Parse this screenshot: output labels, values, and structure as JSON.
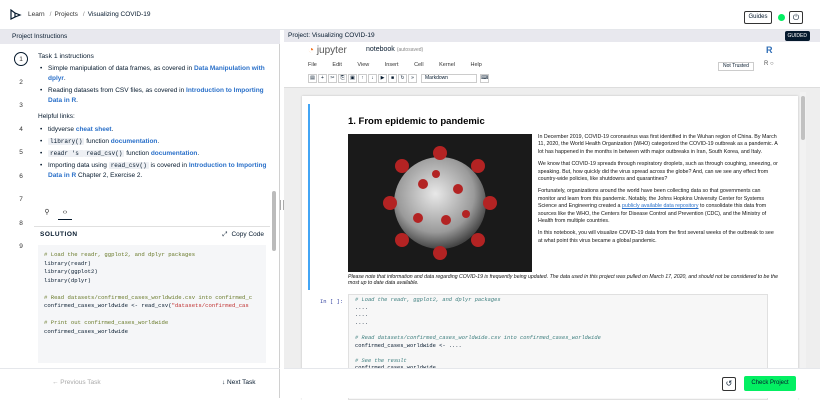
{
  "breadcrumb": {
    "learn": "Learn",
    "projects": "Projects",
    "current": "Visualizing COVID-19"
  },
  "topbar": {
    "guides_label": "Guides",
    "power_icon": "⏻"
  },
  "left_panel": {
    "header": "Project Instructions",
    "steps": [
      "1",
      "2",
      "3",
      "4",
      "5",
      "6",
      "7",
      "8",
      "9"
    ],
    "task_title": "Task 1 instructions",
    "bullets": [
      {
        "pre": "Simple manipulation of data frames, as covered in ",
        "link": "Data Manipulation with dplyr",
        "post": "."
      },
      {
        "pre": "Reading datasets from CSV files, as covered in ",
        "link": "Introduction to Importing Data in R",
        "post": "."
      }
    ],
    "helpful_title": "Helpful links:",
    "helpful": [
      {
        "pre": "tidyverse ",
        "link": "cheat sheet",
        "post": "."
      },
      {
        "code": "library()",
        "mid": " function ",
        "link": "documentation",
        "post": "."
      },
      {
        "pre": "readr 's ",
        "code": "read_csv()",
        "mid": " function ",
        "link": "documentation",
        "post": "."
      },
      {
        "pre": "Importing data using ",
        "code": "read_csv()",
        "mid": " is covered in ",
        "link": "Introduction to Importing Data in R",
        "post": " Chapter 2, Exercise 2."
      }
    ],
    "solution_label": "SOLUTION",
    "copy_label": "Copy Code",
    "code": {
      "c1": "# Load the readr, ggplot2, and dplyr packages",
      "l1": "library(readr)",
      "l2": "library(ggplot2)",
      "l3": "library(dplyr)",
      "c2": "# Read datasets/confirmed_cases_worldwide.csv into confirmed_c",
      "l4a": "confirmed_cases_worldwide <- read_csv(",
      "l4b": "\"datasets/confirmed_cas",
      "c3": "# Print out confirmed_cases_worldwide",
      "l5": "confirmed_cases_worldwide"
    },
    "prev_label": "← Previous Task",
    "next_label": "↓  Next Task"
  },
  "right_panel": {
    "header": "Project: Visualizing COVID-19",
    "guided_badge": "GUIDED",
    "jupyter": {
      "logo": "jupyter",
      "notebook_name": "notebook",
      "autosaved": "(autosaved)"
    },
    "menu": [
      "File",
      "Edit",
      "View",
      "Insert",
      "Cell",
      "Kernel",
      "Help"
    ],
    "not_trusted": "Not Trusted",
    "kernel_status": "R ○",
    "cell_type": "Markdown",
    "markdown": {
      "title": "1. From epidemic to pandemic",
      "p1": "In December 2019, COVID-19 coronavirus was first identified in the Wuhan region of China. By March 11, 2020, the World Health Organization (WHO) categorized the COVID-19 outbreak as a pandemic. A lot has happened in the months in between with major outbreaks in Iran, South Korea, and Italy.",
      "p2": "We know that COVID-19 spreads through respiratory droplets, such as through coughing, sneezing, or speaking. But, how quickly did the virus spread across the globe? And, can we see any effect from country-wide policies, like shutdowns and quarantines?",
      "p3a": "Fortunately, organizations around the world have been collecting data so that governments can monitor and learn from this pandemic. Notably, the Johns Hopkins University Center for Systems Science and Engineering created a ",
      "p3link": "publicly available data repository",
      "p3b": " to consolidate this data from sources like the WHO, the Centers for Disease Control and Prevention (CDC), and the Ministry of Health from multiple countries.",
      "p4": "In this notebook, you will visualize COVID-19 data from the first several weeks of the outbreak to see at what point this virus became a global pandemic.",
      "p5": "Please note that information and data regarding COVID-19 is frequently being updated. The data used in this project was pulled on March 17, 2020, and should not be considered to be the most up to date data available."
    },
    "code_cell": {
      "prompt": "In [ ]:",
      "c1": "# Load the readr, ggplot2, and dplyr packages",
      "d1": "....",
      "d2": "....",
      "d3": "....",
      "c2": "# Read datasets/confirmed_cases_worldwide.csv into confirmed_cases_worldwide",
      "l1": "confirmed_cases_worldwide <- ....",
      "c3": "# See the result",
      "l2": "confirmed_cases_worldwide"
    },
    "check_label": "Check Project"
  },
  "colors": {
    "accent": "#03ef62",
    "link": "#2a70c9",
    "navy": "#05192d"
  }
}
